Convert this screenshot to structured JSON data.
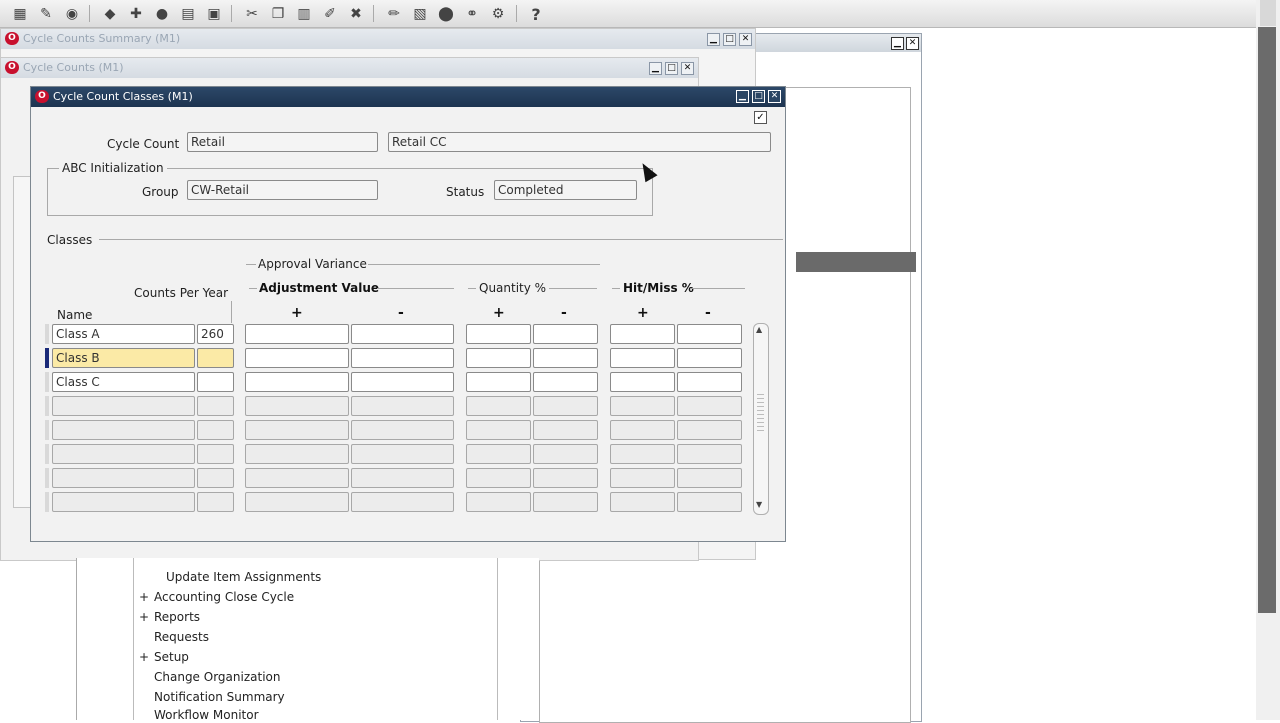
{
  "toolbar": {
    "icons": [
      "new-icon",
      "flashlight-icon",
      "navigator-icon",
      "save-icon",
      "new-record-icon",
      "delete-record-icon",
      "print-icon",
      "folder-icon",
      "cut-icon",
      "copy-icon",
      "paste-icon",
      "edit-field-icon",
      "clear-record-icon",
      "zoom-icon",
      "translation-icon",
      "attachment-icon",
      "folder-tools-icon",
      "help-icon"
    ],
    "help_glyph": "?"
  },
  "windows": {
    "summary_title": "Cycle Counts Summary (M1)",
    "counts_title": "Cycle Counts (M1)",
    "main_title": "Cycle Count Classes (M1)"
  },
  "form": {
    "cycle_count_label": "Cycle Count",
    "cycle_count_value": "Retail",
    "cycle_count_desc": "Retail CC",
    "abc_label": "ABC Initialization",
    "group_label": "Group",
    "group_value": "CW-Retail",
    "status_label": "Status",
    "status_value": "Completed",
    "checkbox_glyph": "✓"
  },
  "classes": {
    "section_label": "Classes",
    "approval_variance_label": "Approval Variance",
    "counts_per_year_label": "Counts Per Year",
    "name_label": "Name",
    "adjustment_value_label": "Adjustment Value",
    "quantity_label": "Quantity %",
    "hitmiss_label": "Hit/Miss %",
    "plus": "+",
    "minus": "-",
    "rows": [
      {
        "name": "Class A",
        "counts": "260"
      },
      {
        "name": "Class B",
        "counts": ""
      },
      {
        "name": "Class C",
        "counts": ""
      },
      {
        "name": "",
        "counts": ""
      },
      {
        "name": "",
        "counts": ""
      },
      {
        "name": "",
        "counts": ""
      },
      {
        "name": "",
        "counts": ""
      },
      {
        "name": "",
        "counts": ""
      }
    ]
  },
  "navigator": {
    "items": [
      {
        "label": "Update Item Assignments",
        "plus": ""
      },
      {
        "label": "Accounting Close Cycle",
        "plus": "+"
      },
      {
        "label": "Reports",
        "plus": "+"
      },
      {
        "label": "Requests",
        "plus": ""
      },
      {
        "label": "Setup",
        "plus": "+"
      },
      {
        "label": "Change Organization",
        "plus": ""
      },
      {
        "label": "Notification Summary",
        "plus": ""
      },
      {
        "label": "Workflow Monitor",
        "plus": ""
      }
    ]
  },
  "colors": {
    "title_bar": "#1d3450",
    "active_cell": "#fbeaa6",
    "row_indicator": "#1a2a78"
  }
}
